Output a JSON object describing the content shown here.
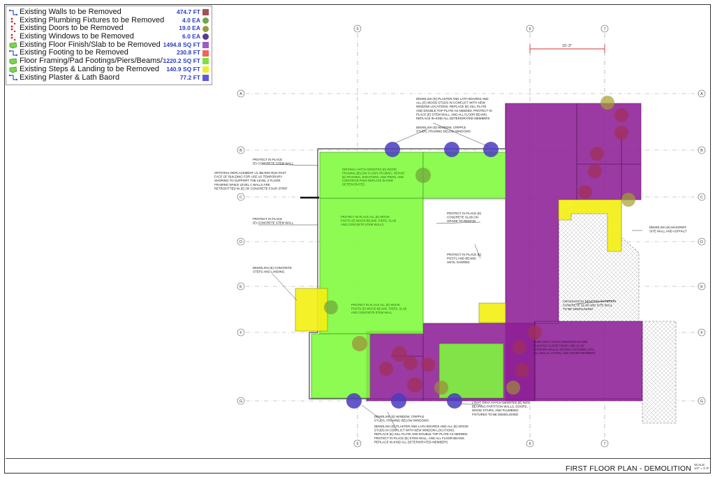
{
  "legend": {
    "items": [
      {
        "label": "Existing Walls to be Removed",
        "qty": "474.7 FT",
        "color": "#a0525a",
        "icon": "wall-line-icon",
        "shape": "square"
      },
      {
        "label": "Existing Plumbing Fixtures to be Removed",
        "qty": "4.0 EA",
        "color": "#6ea84a",
        "icon": "point-dots-icon",
        "shape": "circle"
      },
      {
        "label": "Existing Doors to be Removed",
        "qty": "19.0 EA",
        "color": "#9a9a3a",
        "icon": "point-dots-icon",
        "shape": "circle"
      },
      {
        "label": "Existing Windows to be Removed",
        "qty": "6.0 EA",
        "color": "#5a3c8c",
        "icon": "point-dots-icon",
        "shape": "circle"
      },
      {
        "label": "Existing Floor Finish/Slab to be Removed",
        "qty": "1494.8 SQ FT",
        "color": "#a05ac8",
        "icon": "area-shape-icon",
        "shape": "square"
      },
      {
        "label": "Existing Footing to be Removed",
        "qty": "230.8 FT",
        "color": "#ee6655",
        "icon": "wall-line-icon",
        "shape": "square"
      },
      {
        "label": "Floor Framing/Pad Footings/Piers/Beams/S...",
        "qty": "1220.2 SQ FT",
        "color": "#7ee040",
        "icon": "area-shape-icon",
        "shape": "square"
      },
      {
        "label": "Existing Steps & Landing to be Removed",
        "qty": "140.9 SQ FT",
        "color": "#eeee30",
        "icon": "area-shape-icon",
        "shape": "square"
      },
      {
        "label": "Existing Plaster & Lath Baord",
        "qty": "77.2 FT",
        "color": "#5a5ae0",
        "icon": "wall-line-icon",
        "shape": "square"
      }
    ]
  },
  "grid": {
    "columns": [
      "5",
      "6",
      "7"
    ],
    "rows": [
      "A",
      "B",
      "C",
      "D",
      "E",
      "F",
      "G"
    ],
    "dimension": "15'-3\""
  },
  "notes": [
    {
      "lines": [
        "DEMOLISH (E) PLASTER AND LATH BOARDS AND",
        "ALL (E) WOOD STUDS IN CONFLICT WITH NEW",
        "WINDOW LOCATIONS. REPLACE (E) SILL PLATE",
        "AND DOUBLE TOP PLATE AS NEEDED.  PROTECT IN",
        "PLACE (E) STEM WALL, AND ALL FLOOR BEAMS.",
        "REPLACE IN-KIND ALL DETERIORATED MEMBERS"
      ]
    },
    {
      "lines": [
        "DEMOLISH (E) WINDOW, CRIPPLE",
        "STUDS, FRAMING BELOW WINDOWS"
      ]
    },
    {
      "lines": [
        "PROTECT IN PLACE",
        "(E) CONCRETE STEM WALL"
      ]
    },
    {
      "lines": [
        "OPTIONAL REPLACEMENT L/L BEAMS RUN PAST",
        "FACE OF BUILDING FOR USE AS TEMPORARY",
        "SHORING TO SUPPORT THE LEVEL 2 FLOOR",
        "FRAMING WHILE LEVEL 1 WALLS ARE",
        "RETROFITTED IN (E) OF CONCRETE FOUR STRIP"
      ]
    },
    {
      "lines": [
        "PROTECT IN PLACE",
        "(E) CONCRETE STEM WALL"
      ]
    },
    {
      "lines": [
        "PROTECT IN PLACE (E)",
        "CONCRETE SLAB ON",
        "GRADE TO REMAIN"
      ]
    },
    {
      "lines": [
        "PROTECT IN PLACE (E)",
        "POSTS AND BEAMS",
        "UNTIL SHORED"
      ]
    },
    {
      "lines": [
        "DEMOLISH (E) CONCRETE",
        "STEPS AND LANDING"
      ]
    },
    {
      "lines": [
        "DEMOLISH (E) MASONRY",
        "SITE WALL AND ASPHALT"
      ]
    },
    {
      "lines": [
        "CROSSHATCH DENOTES EXTERIOR",
        "CONCRETE SLAB AND SITE WALL",
        "TO BE DEMOLISHED"
      ]
    },
    {
      "lines": [
        "DEMOLISH (E) WINDOW, CRIPPLE",
        "STUDS, FRAMING BELOW WINDOWS"
      ]
    },
    {
      "lines": [
        "DEMOLISH (E) PLASTER AND LATH BOARDS AND ALL (E) WOOD",
        "STUDS IN CONFLICT WITH NEW WINDOW LOCATIONS.",
        "REPLACE (E) SILL PLATE AND DOUBLE TOP PLATE AS NEEDED.",
        "PROTECT IN PLACE (E) STEM WALL, AND ALL FLOOR BEAMS.",
        "REPLACE IN-KIND ALL DETERIORATED MEMBERS"
      ]
    },
    {
      "lines": [
        "LIGHT GRAY HATCH DENOTES (E) NON",
        "BEARING PARTITION WALLS, DOORS,",
        "WOOD STAIRS, AND PLUMBING",
        "FIXTURES TO BE DEMOLISHED"
      ]
    }
  ],
  "area_notes": [
    {
      "lines": [
        "ORIGINAL HATCH DENOTES (E) WOOD",
        "FRAMING BELOW FLOOR FRAMING. REPAIR",
        "(E) FRAMING, SHEATHING, AND PIERS, AND",
        "CONCRETE PADS REPLACE IN KIND",
        "DETERIORATED"
      ]
    },
    {
      "lines": [
        "PROTECT IN PLACE ALL (E) WOOD",
        "POSTS (E) WOOD BEAMS, PIERS, SLAB",
        "AND CONCRETE STEM WALLS"
      ]
    },
    {
      "lines": [
        "PROTECT IN PLACE ALL (E) WOOD",
        "POSTS (E) WOOD BEAMS, PIERS, SLAB",
        "AND CONCRETE STEM WALL"
      ]
    },
    {
      "lines": [
        "DARK GRAY HATCH DENOTES ENTIRE",
        "BUILDING FLOOR FINISH AND SLAB",
        "INTERIOR WALLS, DOORS, FIXTURES, ETC.",
        "ALL WALLS, STAIRS, AND OTHER MEMBERS"
      ]
    }
  ],
  "title_block": {
    "sheet_title": "FIRST FLOOR PLAN - DEMOLITION",
    "scale": "SCALE: 1/4\" = 1'-0\""
  }
}
